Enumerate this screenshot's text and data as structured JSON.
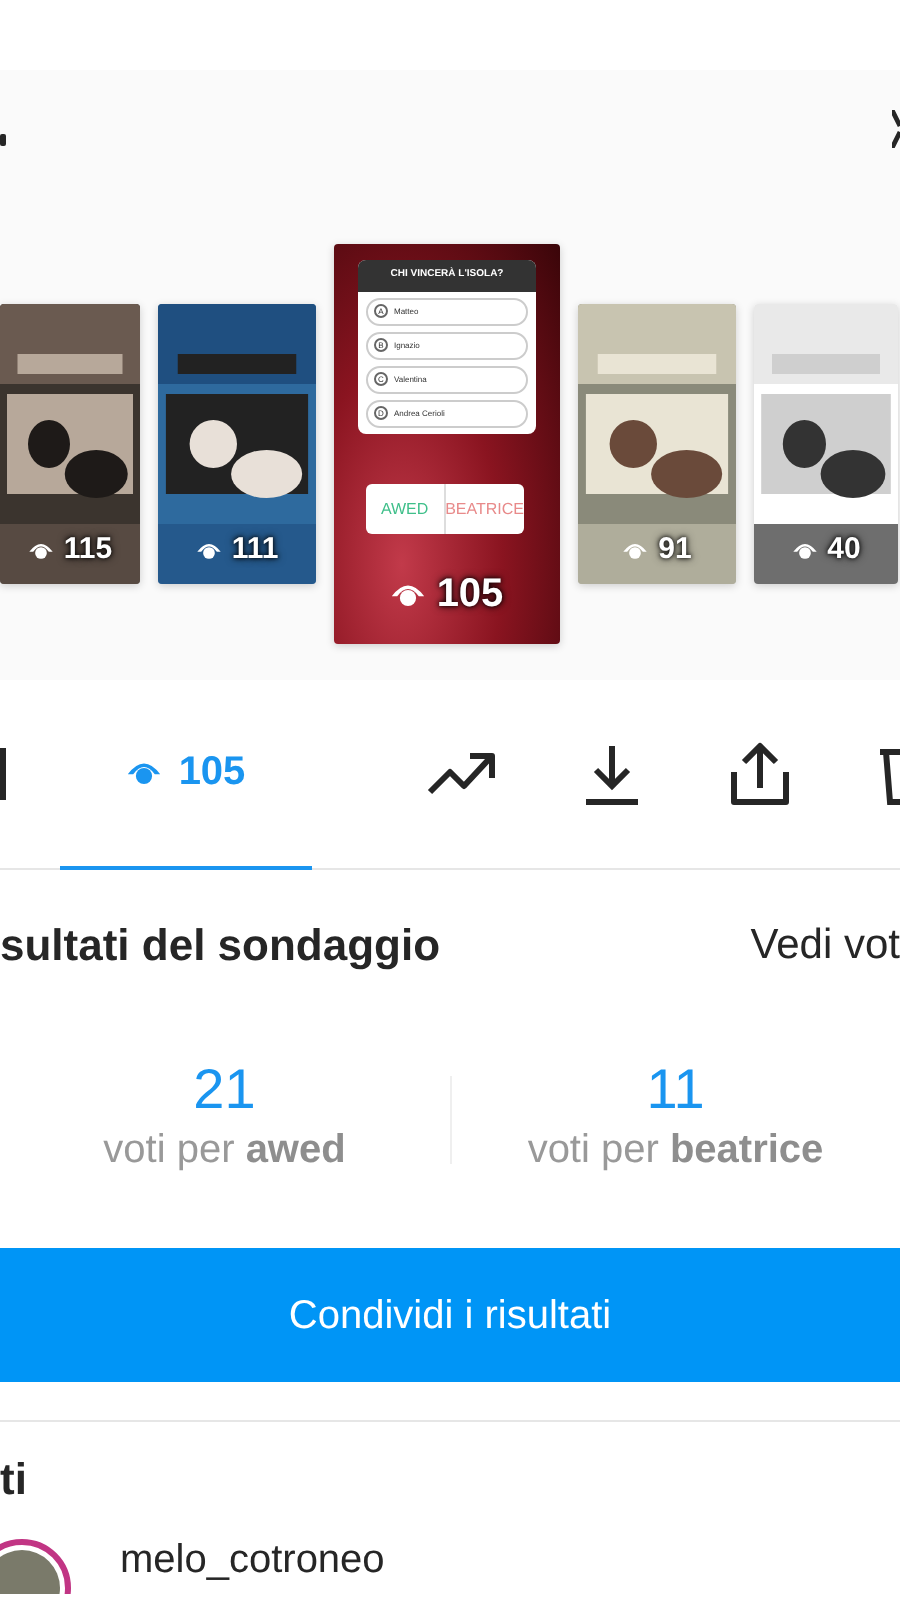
{
  "stories": [
    {
      "kind": "picture",
      "views": "115",
      "selected": false
    },
    {
      "kind": "picture",
      "views": "111",
      "selected": false
    },
    {
      "kind": "poll",
      "views": "105",
      "selected": true,
      "poll": {
        "question": "CHI VINCERÀ L'ISOLA?",
        "options": [
          {
            "letter": "A",
            "label": "Matteo"
          },
          {
            "letter": "B",
            "label": "Ignazio"
          },
          {
            "letter": "C",
            "label": "Valentina"
          },
          {
            "letter": "D",
            "label": "Andrea Cerioli"
          }
        ],
        "answers": [
          "AWED",
          "BEATRICE"
        ]
      }
    },
    {
      "kind": "picture",
      "views": "91",
      "selected": false
    },
    {
      "kind": "picture",
      "views": "40",
      "selected": false
    }
  ],
  "tabs": [
    {
      "kind": "grid",
      "selected": false
    },
    {
      "kind": "views",
      "label": "105",
      "selected": true
    },
    {
      "kind": "insights",
      "selected": false
    },
    {
      "kind": "download",
      "selected": false
    },
    {
      "kind": "share",
      "selected": false
    },
    {
      "kind": "delete",
      "selected": false
    }
  ],
  "results": {
    "title": "sultati del sondaggio",
    "link": "Vedi vot",
    "options": [
      {
        "count": "21",
        "caption": "voti per **awed**"
      },
      {
        "count": "11",
        "caption": "voti per **beatrice**"
      }
    ]
  },
  "share_button": "Condividi i risultati",
  "viewers_title": "ti",
  "viewers": [
    {
      "username": "melo_cotroneo"
    }
  ]
}
